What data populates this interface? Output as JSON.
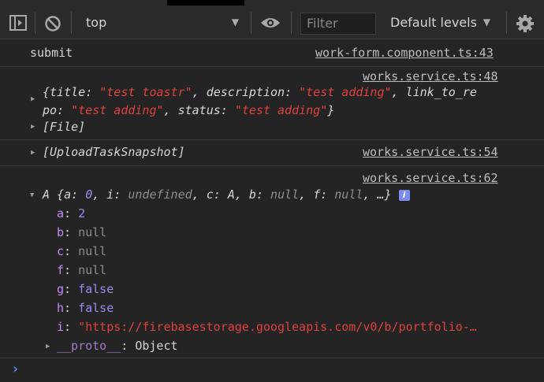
{
  "toolbar": {
    "context": "top",
    "filter_placeholder": "Filter",
    "levels": "Default levels"
  },
  "messages": {
    "submit": {
      "text": "submit",
      "source": "work-form.component.ts:43"
    },
    "obj": {
      "source": "works.service.ts:48",
      "line1": {
        "open": "{",
        "k1": "title",
        "v1": "\"test toastr\"",
        "k2": "description",
        "v2": "\"test adding\"",
        "k3a": "link_to_re"
      },
      "line2": {
        "k3b": "po",
        "v3": "\"test adding\"",
        "k4": "status",
        "v4": "\"test adding\"",
        "close": "}"
      },
      "file": "[File]"
    },
    "upload": {
      "text": "[UploadTaskSnapshot]",
      "source": "works.service.ts:54"
    },
    "a_obj": {
      "source": "works.service.ts:62",
      "summary": {
        "name": "A",
        "a_val": "0",
        "i_val": "undefined",
        "c_val": "A",
        "b_val": "null",
        "f_val": "null",
        "ellipsis": "…"
      },
      "props": [
        {
          "key": "a",
          "value": "2"
        },
        {
          "key": "b",
          "value": "null"
        },
        {
          "key": "c",
          "value": "null"
        },
        {
          "key": "f",
          "value": "null"
        },
        {
          "key": "g",
          "value": "false"
        },
        {
          "key": "h",
          "value": "false"
        },
        {
          "key": "i",
          "value": "\"https://firebasestorage.googleapis.com/v0/b/portfolio-…"
        }
      ],
      "proto_key": "__proto__",
      "proto_val": "Object"
    }
  },
  "prompt": "›"
}
